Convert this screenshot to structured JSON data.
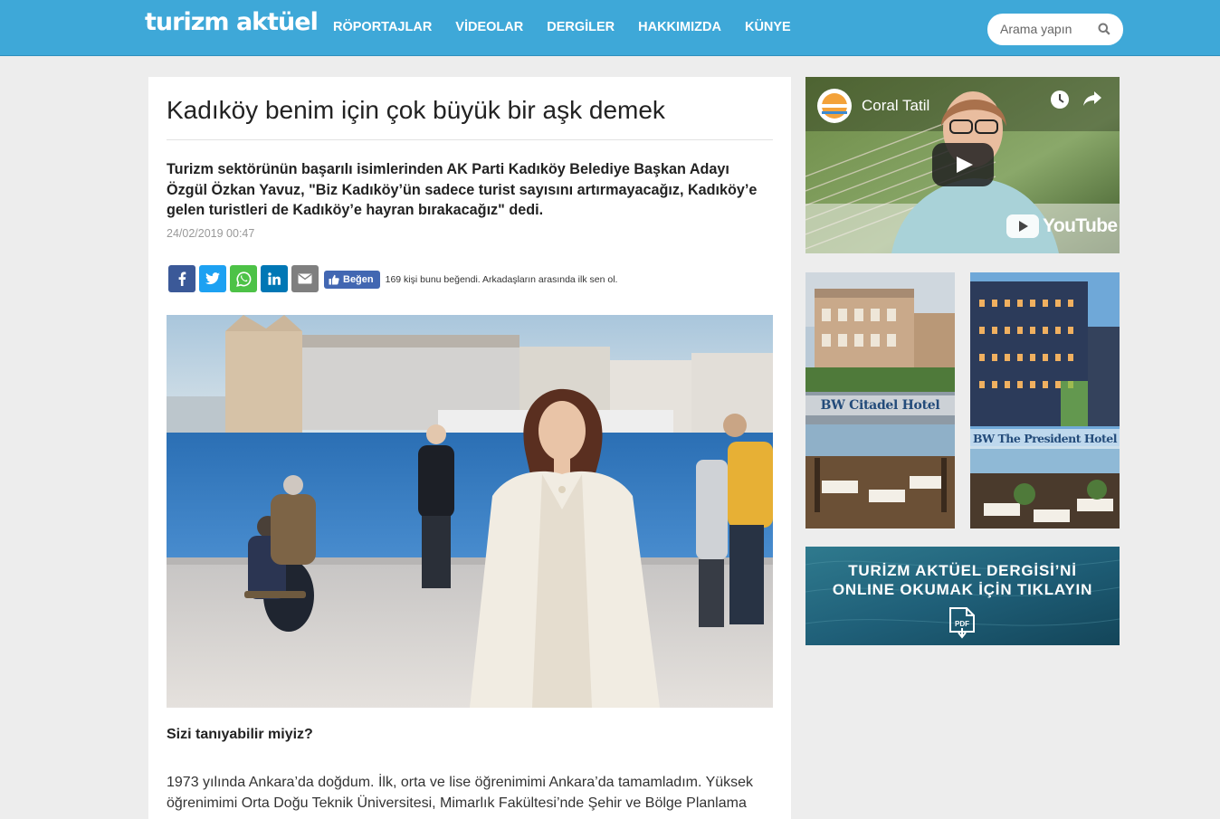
{
  "header": {
    "logo": "turizm aktüel",
    "nav": [
      "RÖPORTAJLAR",
      "VİDEOLAR",
      "DERGİLER",
      "HAKKIMIZDA",
      "KÜNYE"
    ],
    "search_placeholder": "Arama yapın",
    "accent_color": "#3ea8d8"
  },
  "article": {
    "title": "Kadıköy benim için çok büyük bir aşk demek",
    "lead": "Turizm sektörünün başarılı isimlerinden AK Parti Kadıköy Belediye Başkan Adayı Özgül Özkan Yavuz, \"Biz Kadıköy’ün sadece turist sayısını artırmayacağız, Kadıköy’e gelen turistleri de Kadıköy’e hayran bırakacağız\" dedi.",
    "date": "24/02/2019 00:47",
    "share_icons": [
      "facebook-icon",
      "twitter-icon",
      "whatsapp-icon",
      "linkedin-icon",
      "email-icon"
    ],
    "like_label": "Beğen",
    "like_text": "169 kişi bunu beğendi. Arkadaşların arasında ilk sen ol.",
    "subheading": "Sizi tanıyabilir miyiz?",
    "body": "1973 yılında Ankara’da doğdum. İlk, orta ve lise öğrenimimi Ankara’da tamamladım. Yüksek öğrenimimi Orta Doğu Teknik Üniversitesi, Mimarlık Fakültesi’nde Şehir ve Bölge Planlama"
  },
  "sidebar": {
    "video": {
      "channel": "Coral Tatil",
      "platform": "YouTube"
    },
    "hotels": [
      "BW Citadel Hotel",
      "BW The President Hotel"
    ],
    "banner": {
      "line1": "TURİZM AKTÜEL DERGİSİ’Nİ",
      "line2": "ONLINE OKUMAK İÇİN TIKLAYIN",
      "icon_label": "PDF"
    }
  }
}
